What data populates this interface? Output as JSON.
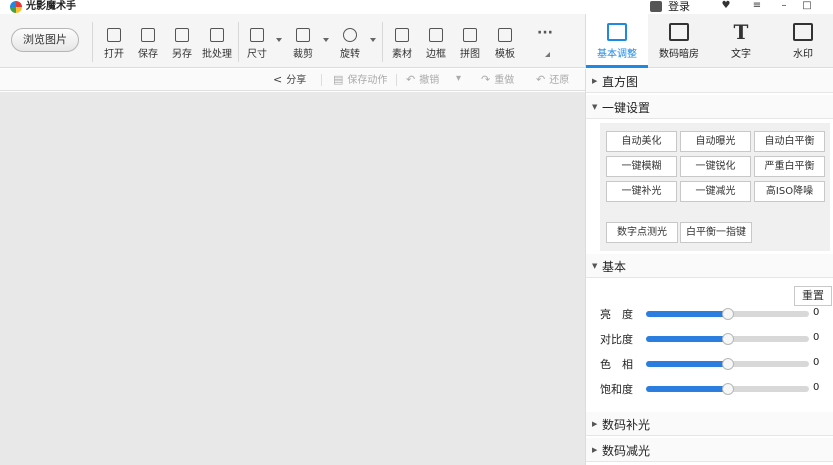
{
  "app": {
    "title": "光影魔术手"
  },
  "titlebar": {
    "login": "登录",
    "btn_skin": "♥",
    "btn_menu": "≡",
    "btn_min": "–",
    "btn_max": "□"
  },
  "toolbar": {
    "browse": "浏览图片",
    "tools": [
      {
        "icon": "open-icon",
        "label": "打开"
      },
      {
        "icon": "save-icon",
        "label": "保存"
      },
      {
        "icon": "save-as-icon",
        "label": "另存"
      },
      {
        "icon": "batch-icon",
        "label": "批处理"
      },
      {
        "icon": "resize-icon",
        "label": "尺寸"
      },
      {
        "icon": "crop-icon",
        "label": "裁剪"
      },
      {
        "icon": "rotate-icon",
        "label": "旋转"
      },
      {
        "icon": "material-icon",
        "label": "素材"
      },
      {
        "icon": "border-icon",
        "label": "边框"
      },
      {
        "icon": "collage-icon",
        "label": "拼图"
      },
      {
        "icon": "template-icon",
        "label": "模板"
      },
      {
        "icon": "more-icon",
        "label": "···"
      }
    ]
  },
  "actions": {
    "share": "分享",
    "save_action": "保存动作",
    "undo": "撤销",
    "redo": "重做",
    "restore": "还原"
  },
  "right_tabs": [
    {
      "icon": "basic-adjust-icon",
      "label": "基本调整"
    },
    {
      "icon": "darkroom-icon",
      "label": "数码暗房"
    },
    {
      "icon": "text-icon",
      "label": "文字",
      "glyph": "T"
    },
    {
      "icon": "watermark-icon",
      "label": "水印"
    }
  ],
  "panel": {
    "histogram": "直方图",
    "one_click": "一键设置",
    "one_click_buttons": [
      "自动美化",
      "自动曝光",
      "自动白平衡",
      "一键模糊",
      "一键锐化",
      "严重白平衡",
      "一键补光",
      "一键减光",
      "高ISO降噪"
    ],
    "extra_buttons": [
      "数字点测光",
      "白平衡一指键"
    ],
    "basic": "基本",
    "reset": "重置",
    "sliders": [
      {
        "label": "亮　度",
        "value": "0",
        "level": 0.5
      },
      {
        "label": "对比度",
        "value": "0",
        "level": 0.5
      },
      {
        "label": "色　相",
        "value": "0",
        "level": 0.5
      },
      {
        "label": "饱和度",
        "value": "0",
        "level": 0.5
      }
    ],
    "fill_light": "数码补光",
    "reduce_light": "数码减光"
  }
}
